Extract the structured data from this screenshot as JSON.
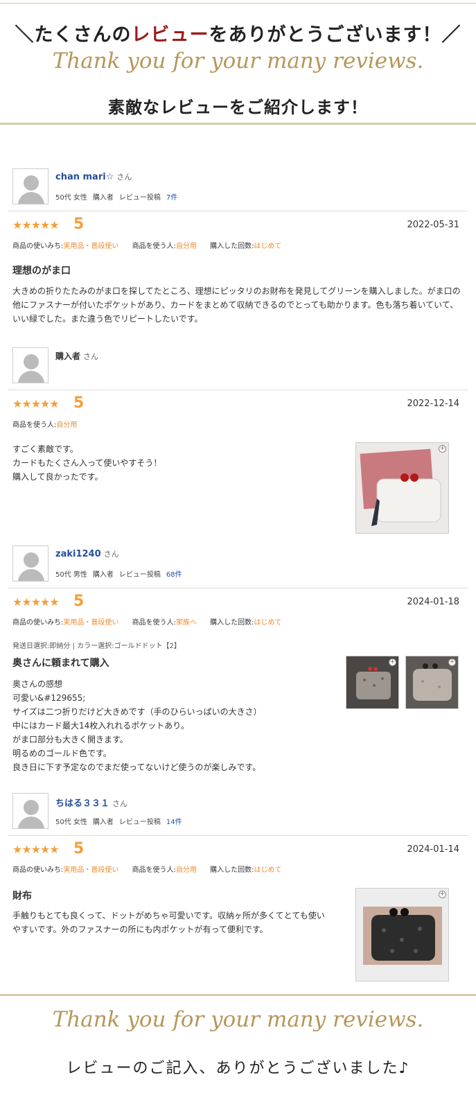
{
  "header": {
    "title_pre": "＼たくさんの",
    "title_accent": "レビュー",
    "title_post": "をありがとうございます！／",
    "script": "Thank you for your many reviews.",
    "subtitle": "素敵なレビューをご紹介します！"
  },
  "reviews": [
    {
      "user": "chan mari☆",
      "san": "さん",
      "meta": {
        "age_gender": "50代 女性",
        "buyer": "購入者",
        "review_label": "レビュー投稿",
        "review_count": "7件"
      },
      "stars": "★★★★★",
      "score": "5",
      "date": "2022-05-31",
      "attrs": [
        {
          "label": "商品の使いみち:",
          "value": "実用品・普段使い"
        },
        {
          "label": "商品を使う人:",
          "value": "自分用"
        },
        {
          "label": "購入した回数:",
          "value": "はじめて"
        }
      ],
      "title": "理想のがま口",
      "body": "大きめの折りたたみのがま口を探してたところ、理想にピッタリのお財布を発見してグリーンを購入しました。がま口の他にファスナーが付いたポケットがあり、カードをまとめて収納できるのでとっても助かります。色も落ち着いていて、いい緑でした。また違う色でリピートしたいです。"
    },
    {
      "user": "購入者",
      "san": "さん",
      "stars": "★★★★★",
      "score": "5",
      "date": "2022-12-14",
      "attrs": [
        {
          "label": "商品を使う人:",
          "value": "自分用"
        }
      ],
      "body": "すごく素敵です。\nカードもたくさん入って使いやすそう！\n購入して良かったです。",
      "photo_icon": "zoom-icon"
    },
    {
      "user": "zaki1240",
      "san": "さん",
      "meta": {
        "age_gender": "50代 男性",
        "buyer": "購入者",
        "review_label": "レビュー投稿",
        "review_count": "68件"
      },
      "stars": "★★★★★",
      "score": "5",
      "date": "2024-01-18",
      "attrs": [
        {
          "label": "商品の使いみち:",
          "value": "実用品・普段使い"
        },
        {
          "label": "商品を使う人:",
          "value": "家族へ"
        },
        {
          "label": "購入した回数:",
          "value": "はじめて"
        }
      ],
      "variant": "発送日選択:即納分 | カラー選択:ゴールドドット【2】",
      "title": "奥さんに頼まれて購入",
      "body": "奥さんの感想\n可愛い&#129655;\nサイズは二つ折りだけど大きめです（手のひらいっぱいの大きさ）\n中にはカード最大14枚入れれるポケットあり。\nがま口部分も大きく開きます。\n明るめのゴールド色です。\n良き日に下す予定なのでまだ使ってないけど使うのが楽しみです。"
    },
    {
      "user": "ちはる３３１",
      "san": "さん",
      "meta": {
        "age_gender": "50代 女性",
        "buyer": "購入者",
        "review_label": "レビュー投稿",
        "review_count": "14件"
      },
      "stars": "★★★★★",
      "score": "5",
      "date": "2024-01-14",
      "attrs": [
        {
          "label": "商品の使いみち:",
          "value": "実用品・普段使い"
        },
        {
          "label": "商品を使う人:",
          "value": "自分用"
        },
        {
          "label": "購入した回数:",
          "value": "はじめて"
        }
      ],
      "title": "財布",
      "body": "手触りもとても良くって、ドットがめちゃ可愛いです。収納ヶ所が多くてとても使いやすいです。外のファスナーの所にも内ポケットが有って便利です。"
    }
  ],
  "footer": {
    "script": "Thank you for your many reviews.",
    "text": "レビューのご記入、ありがとうございました♪"
  },
  "colors": {
    "accent": "#9b1c1c",
    "gold": "#b6975a",
    "star": "#f2a03d",
    "attr_value": "#f08a2a",
    "link": "#264f9c"
  }
}
